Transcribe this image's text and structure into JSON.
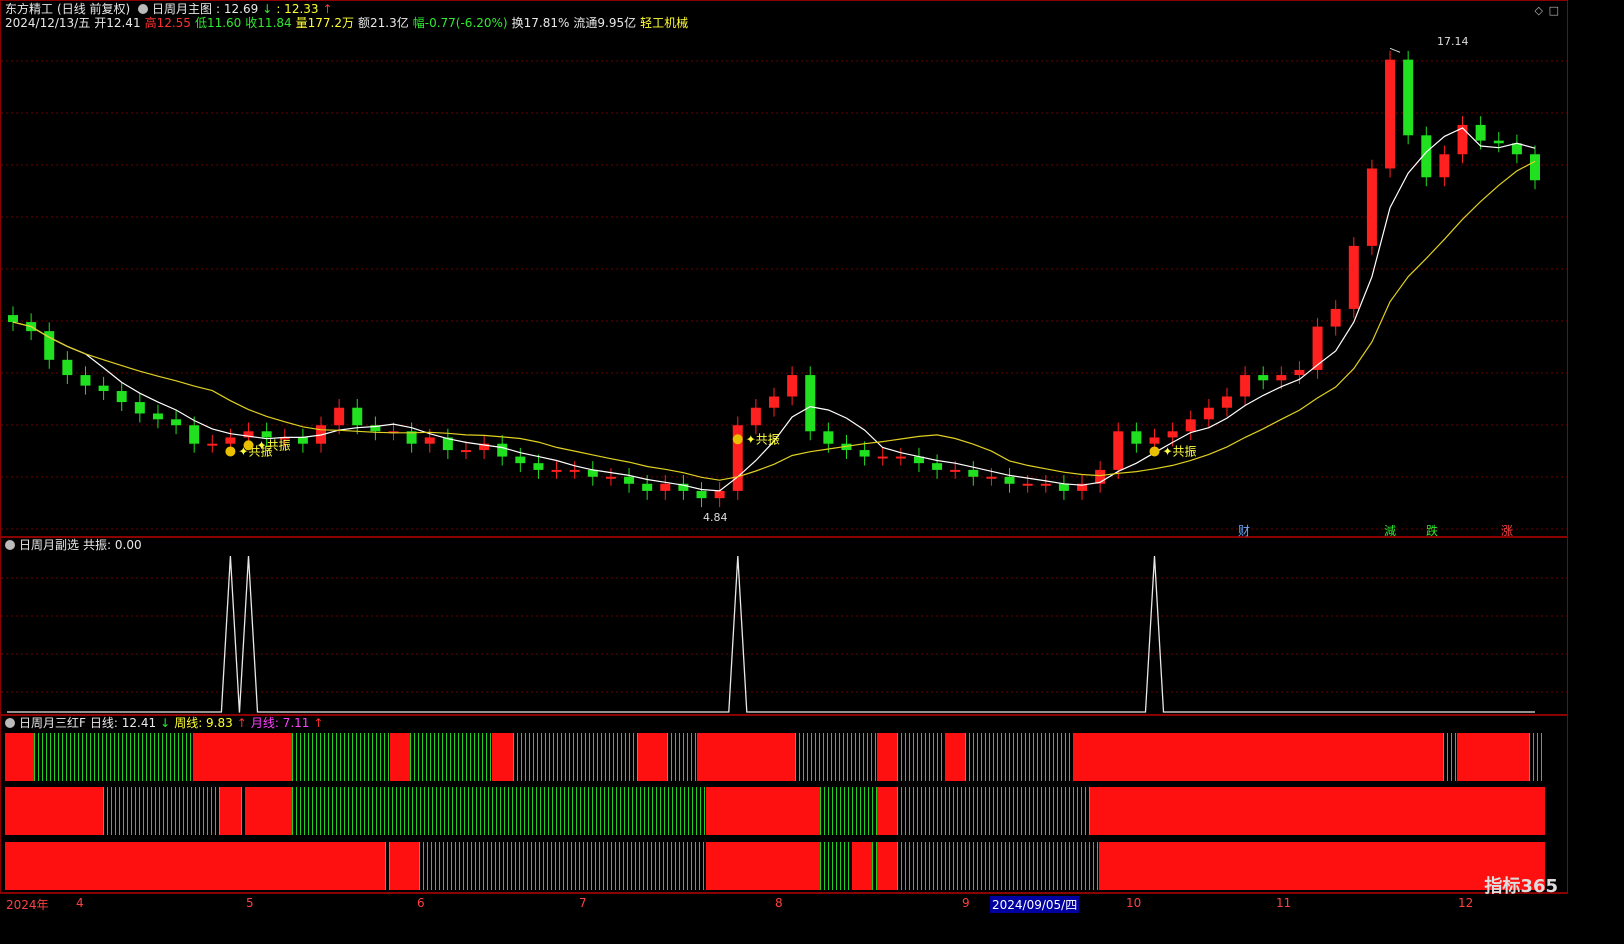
{
  "header": {
    "stock_name": "东方精工",
    "period_note": "(日线 前复权)",
    "indicator_name": "日周月主图",
    "ind_val1": ": 12.69",
    "ind_val2": ": 12.33",
    "date": "2024/12/13/五",
    "open": "开12.41",
    "high": "高12.55",
    "low": "低11.60",
    "close": "收11.84",
    "volume": "量177.2万",
    "amount": "额21.3亿",
    "change": "幅-0.77(-6.20%)",
    "turnover": "换17.81%",
    "float_cap": "流通9.95亿",
    "industry": "轻工机械"
  },
  "main": {
    "price_high_label": "17.14",
    "price_low_label": "4.84",
    "signal_label": "共振",
    "event_marks": [
      {
        "text": "财",
        "color": "#6aa8ff"
      },
      {
        "text": "減",
        "color": "#30e830"
      },
      {
        "text": "跌",
        "color": "#30e830"
      },
      {
        "text": "涨",
        "color": "#ff4040"
      }
    ]
  },
  "sub": {
    "title": "日周月副选",
    "series_label": "共振: 0.00"
  },
  "bars": {
    "title": "日周月三红F",
    "daily": "日线: 12.41",
    "weekly": "周线: 9.83",
    "monthly": "月线: 7.11"
  },
  "axis": {
    "labels": [
      "2024年",
      "4",
      "5",
      "6",
      "7",
      "8",
      "9",
      "2024/09/05/四",
      "10",
      "11",
      "12"
    ]
  },
  "watermark": "指标365",
  "colors": {
    "up": "#ff2020",
    "down": "#20e020",
    "ma1": "#ffffff",
    "ma2": "#e0d020"
  },
  "chart_data": {
    "type": "candlestick",
    "close_prices": [
      7.9,
      7.7,
      7.1,
      6.8,
      6.6,
      6.5,
      6.3,
      6.1,
      6.0,
      5.9,
      5.6,
      5.6,
      5.7,
      5.8,
      5.7,
      5.7,
      5.6,
      5.9,
      6.2,
      5.9,
      5.8,
      5.8,
      5.6,
      5.7,
      5.5,
      5.5,
      5.6,
      5.4,
      5.3,
      5.2,
      5.2,
      5.2,
      5.1,
      5.1,
      5.0,
      4.9,
      5.0,
      4.9,
      4.8,
      4.9,
      5.9,
      6.2,
      6.4,
      6.8,
      5.8,
      5.6,
      5.5,
      5.4,
      5.4,
      5.4,
      5.3,
      5.2,
      5.2,
      5.1,
      5.1,
      5.0,
      5.0,
      5.0,
      4.9,
      5.0,
      5.2,
      5.8,
      5.6,
      5.7,
      5.8,
      6.0,
      6.2,
      6.4,
      6.8,
      6.7,
      6.8,
      6.9,
      7.8,
      8.2,
      9.8,
      12.2,
      16.6,
      13.4,
      11.9,
      12.7,
      13.8,
      13.2,
      13.1,
      12.7,
      11.8
    ],
    "high_label": 17.14,
    "low_label": 4.84,
    "signal_points": [
      12,
      13,
      40,
      63
    ]
  }
}
